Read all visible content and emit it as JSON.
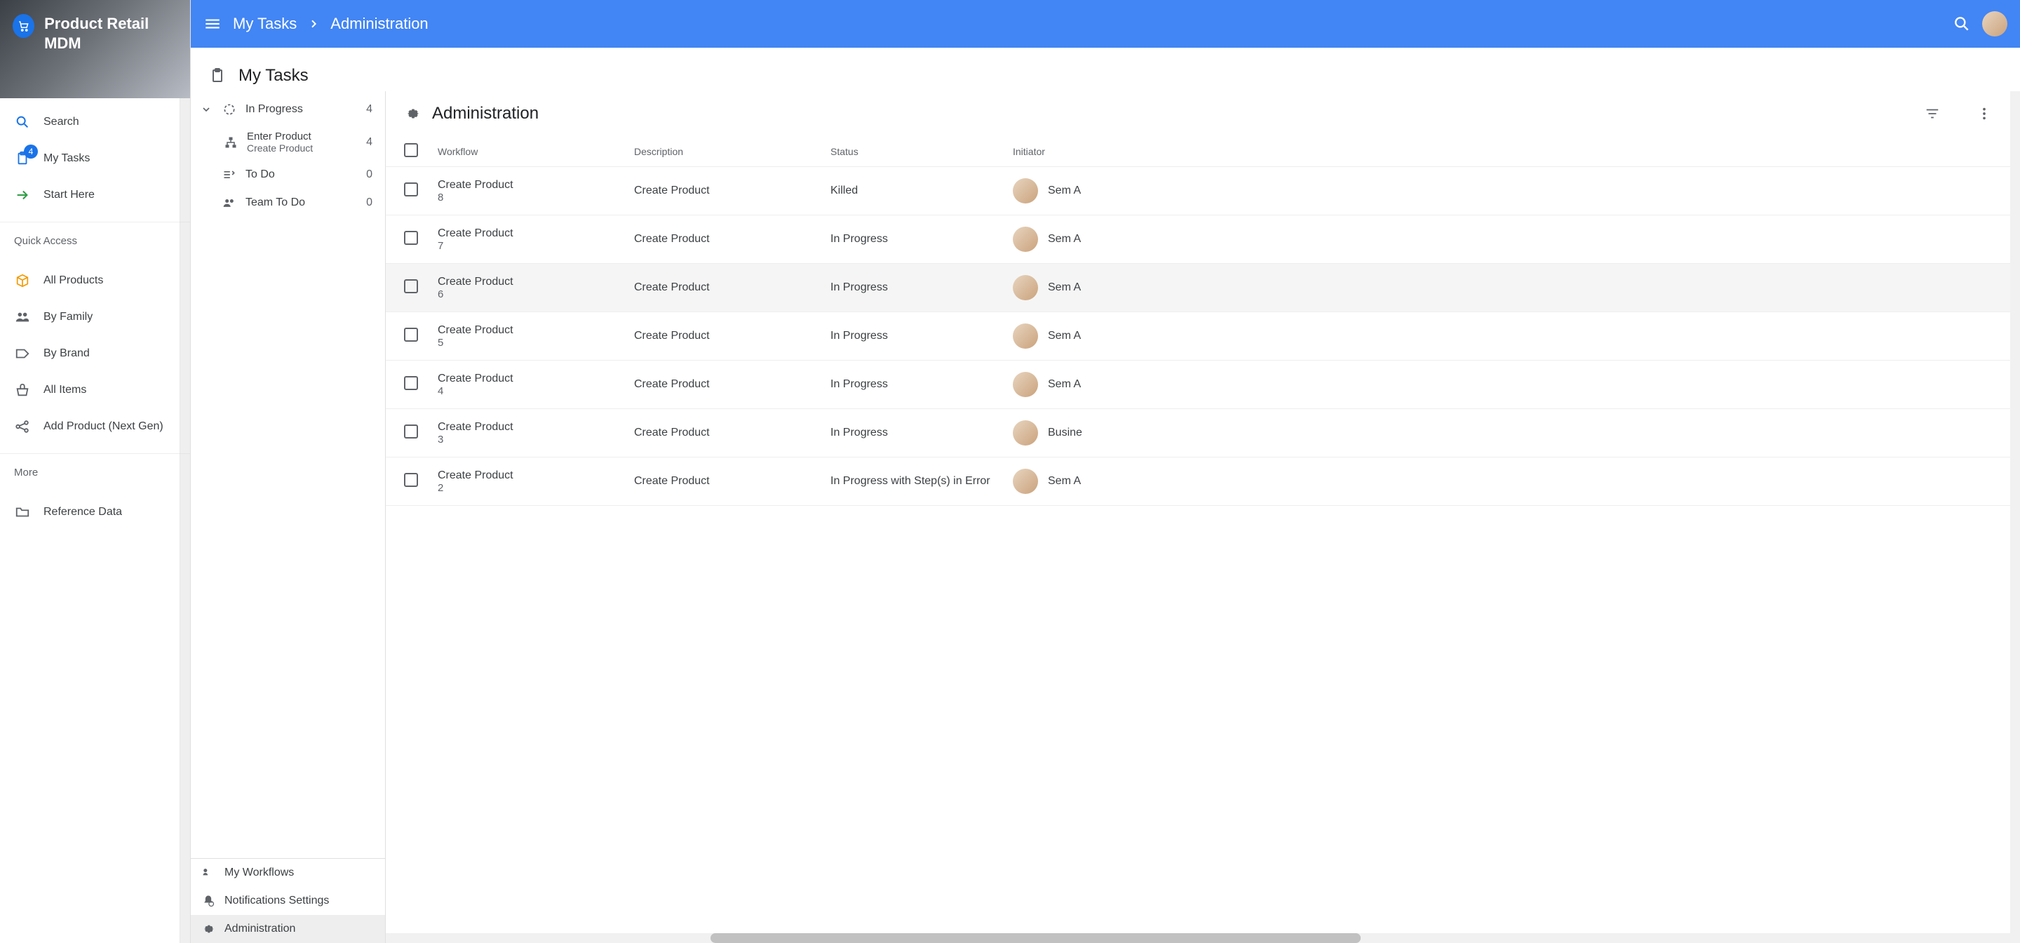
{
  "app": {
    "title": "Product Retail MDM"
  },
  "sidebar": {
    "search": "Search",
    "my_tasks": "My Tasks",
    "my_tasks_badge": "4",
    "start_here": "Start Here",
    "quick_access": "Quick Access",
    "all_products": "All Products",
    "by_family": "By Family",
    "by_brand": "By Brand",
    "all_items": "All Items",
    "add_product": "Add Product (Next Gen)",
    "more": "More",
    "reference_data": "Reference Data"
  },
  "topbar": {
    "crumb1": "My Tasks",
    "crumb2": "Administration"
  },
  "page": {
    "title": "My Tasks"
  },
  "categories": {
    "in_progress": {
      "label": "In Progress",
      "count": "4"
    },
    "enter_product": {
      "label": "Enter Product",
      "sub": "Create Product",
      "count": "4"
    },
    "to_do": {
      "label": "To Do",
      "count": "0"
    },
    "team_to_do": {
      "label": "Team To Do",
      "count": "0"
    }
  },
  "bottom_links": {
    "my_workflows": "My Workflows",
    "notif": "Notifications Settings",
    "admin": "Administration"
  },
  "table": {
    "title": "Administration",
    "columns": {
      "workflow": "Workflow",
      "description": "Description",
      "status": "Status",
      "initiator": "Initiator"
    },
    "rows": [
      {
        "wf": "Create Product",
        "id": "8",
        "desc": "Create Product",
        "status": "Killed",
        "init": "Sem A"
      },
      {
        "wf": "Create Product",
        "id": "7",
        "desc": "Create Product",
        "status": "In Progress",
        "init": "Sem A"
      },
      {
        "wf": "Create Product",
        "id": "6",
        "desc": "Create Product",
        "status": "In Progress",
        "init": "Sem A"
      },
      {
        "wf": "Create Product",
        "id": "5",
        "desc": "Create Product",
        "status": "In Progress",
        "init": "Sem A"
      },
      {
        "wf": "Create Product",
        "id": "4",
        "desc": "Create Product",
        "status": "In Progress",
        "init": "Sem A"
      },
      {
        "wf": "Create Product",
        "id": "3",
        "desc": "Create Product",
        "status": "In Progress",
        "init": "Busine"
      },
      {
        "wf": "Create Product",
        "id": "2",
        "desc": "Create Product",
        "status": "In Progress with Step(s) in Error",
        "init": "Sem A"
      }
    ]
  }
}
